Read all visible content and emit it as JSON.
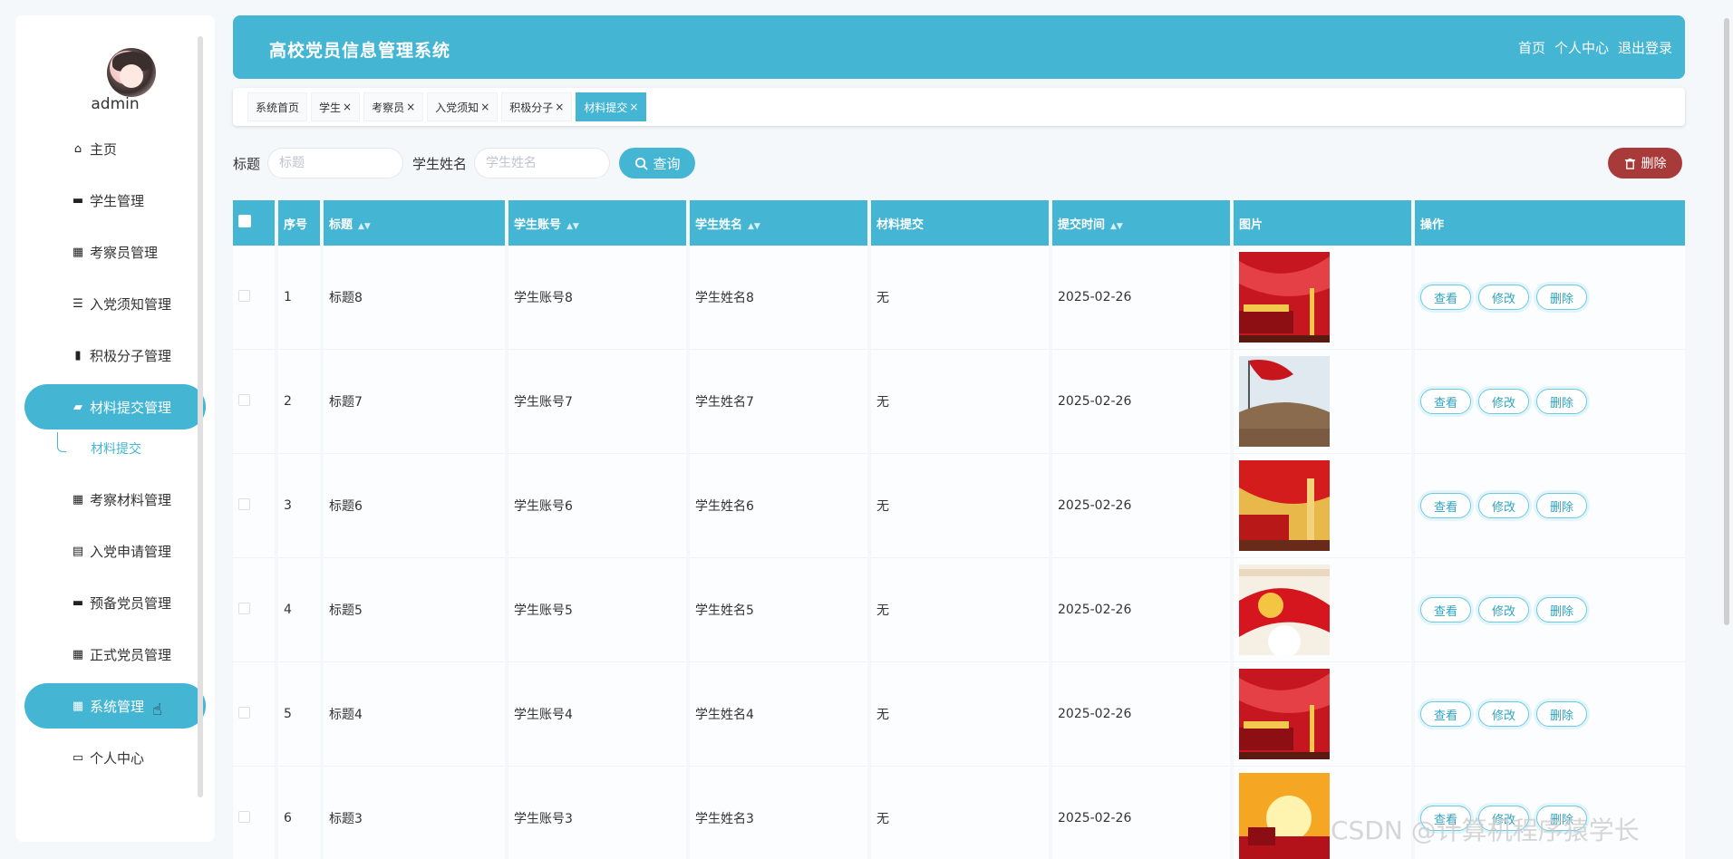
{
  "sidebar": {
    "username": "admin",
    "items": [
      {
        "label": "主页",
        "icon": "home-icon",
        "glyph": "⌂"
      },
      {
        "label": "学生管理",
        "icon": "student-icon",
        "glyph": "▬"
      },
      {
        "label": "考察员管理",
        "icon": "grid-icon",
        "glyph": "▦"
      },
      {
        "label": "入党须知管理",
        "icon": "list-icon",
        "glyph": "☰"
      },
      {
        "label": "积极分子管理",
        "icon": "bar-chart-icon",
        "glyph": "▮"
      },
      {
        "label": "材料提交管理",
        "icon": "folder-icon",
        "glyph": "▰"
      },
      {
        "label": "考察材料管理",
        "icon": "grid-icon",
        "glyph": "▦"
      },
      {
        "label": "入党申请管理",
        "icon": "clipboard-icon",
        "glyph": "▤"
      },
      {
        "label": "预备党员管理",
        "icon": "ticket-icon",
        "glyph": "▬"
      },
      {
        "label": "正式党员管理",
        "icon": "grid-icon",
        "glyph": "▦"
      },
      {
        "label": "系统管理",
        "icon": "grid-icon",
        "glyph": "▦"
      },
      {
        "label": "个人中心",
        "icon": "card-icon",
        "glyph": "▭"
      }
    ],
    "submenu_label": "材料提交"
  },
  "header": {
    "title": "高校党员信息管理系统",
    "links": [
      "首页",
      "个人中心",
      "退出登录"
    ]
  },
  "tabs": [
    {
      "label": "系统首页",
      "closable": false
    },
    {
      "label": "学生",
      "closable": true
    },
    {
      "label": "考察员",
      "closable": true
    },
    {
      "label": "入党须知",
      "closable": true
    },
    {
      "label": "积极分子",
      "closable": true
    },
    {
      "label": "材料提交",
      "closable": true,
      "active": true
    }
  ],
  "search": {
    "title_label": "标题",
    "title_placeholder": "标题",
    "name_label": "学生姓名",
    "name_placeholder": "学生姓名",
    "query_label": "查询",
    "delete_label": "删除"
  },
  "table": {
    "columns": [
      "序号",
      "标题",
      "学生账号",
      "学生姓名",
      "材料提交",
      "提交时间",
      "图片",
      "操作"
    ],
    "actions": [
      "查看",
      "修改",
      "删除"
    ],
    "rows": [
      {
        "index": "1",
        "title": "标题8",
        "account": "学生账号8",
        "name": "学生姓名8",
        "material": "无",
        "time": "2025-02-26",
        "image": "flag-gate"
      },
      {
        "index": "2",
        "title": "标题7",
        "account": "学生账号7",
        "name": "学生姓名7",
        "material": "无",
        "time": "2025-02-26",
        "image": "flag-statue"
      },
      {
        "index": "3",
        "title": "标题6",
        "account": "学生账号6",
        "name": "学生姓名6",
        "material": "无",
        "time": "2025-02-26",
        "image": "gate-column"
      },
      {
        "index": "4",
        "title": "标题5",
        "account": "学生账号5",
        "name": "学生姓名5",
        "material": "无",
        "time": "2025-02-26",
        "image": "party-emblem"
      },
      {
        "index": "5",
        "title": "标题4",
        "account": "学生账号4",
        "name": "学生姓名4",
        "material": "无",
        "time": "2025-02-26",
        "image": "flag-gate"
      },
      {
        "index": "6",
        "title": "标题3",
        "account": "学生账号3",
        "name": "学生姓名3",
        "material": "无",
        "time": "2025-02-26",
        "image": "sunrise-gate"
      }
    ]
  },
  "watermark": "CSDN @计算机程序猿学长",
  "colors": {
    "primary": "#44b5d2",
    "danger": "#a83a3a"
  }
}
